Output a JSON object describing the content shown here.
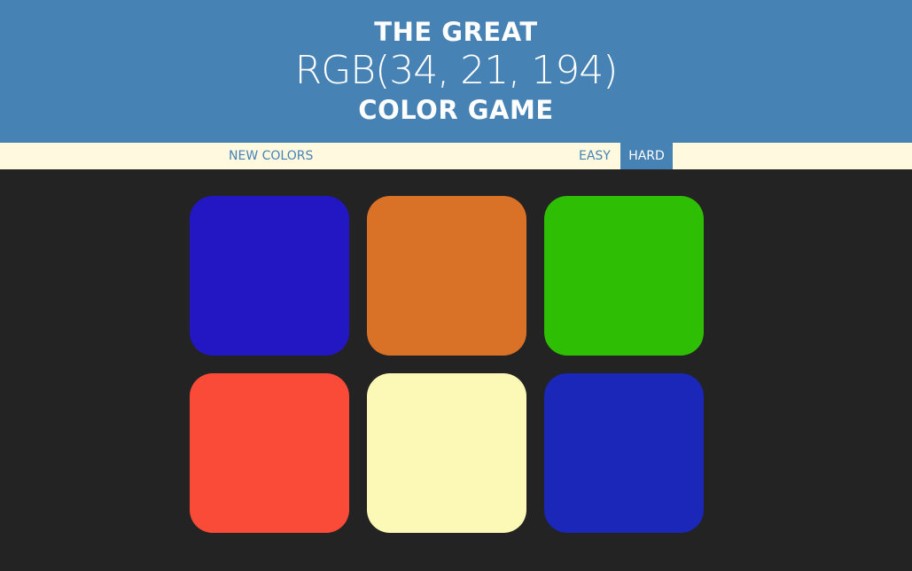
{
  "header": {
    "title_top": "THE GREAT",
    "rgb_display": "RGB(34, 21, 194)",
    "title_bottom": "COLOR GAME",
    "background": "#4682b4"
  },
  "stripe": {
    "new_colors_label": "NEW COLORS",
    "easy_label": "EASY",
    "hard_label": "HARD",
    "selected_mode": "hard",
    "background": "#fffadf"
  },
  "board": {
    "background": "#232323",
    "squares": [
      {
        "color": "#2217c2"
      },
      {
        "color": "#d97126"
      },
      {
        "color": "#2ebf04"
      },
      {
        "color": "#fa4b38"
      },
      {
        "color": "#fcf8b6"
      },
      {
        "color": "#1a27b8"
      }
    ]
  }
}
